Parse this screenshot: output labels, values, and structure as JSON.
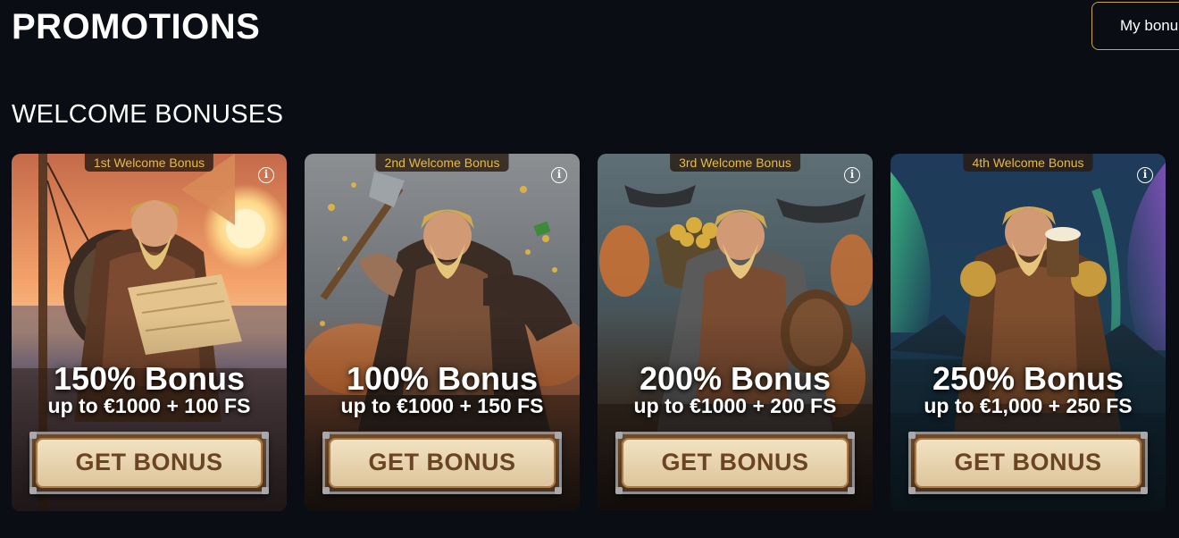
{
  "header": {
    "title": "PROMOTIONS",
    "my_bonus_label": "My bonu"
  },
  "section": {
    "title": "WELCOME BONUSES"
  },
  "cards": [
    {
      "badge": "1st Welcome Bonus",
      "title": "150% Bonus",
      "subtitle": "up to €1000 + 100 FS",
      "cta": "GET BONUS"
    },
    {
      "badge": "2nd Welcome Bonus",
      "title": "100% Bonus",
      "subtitle": "up to €1000 + 150 FS",
      "cta": "GET BONUS"
    },
    {
      "badge": "3rd Welcome Bonus",
      "title": "200% Bonus",
      "subtitle": "up to €1000 + 200 FS",
      "cta": "GET BONUS"
    },
    {
      "badge": "4th Welcome Bonus",
      "title": "250% Bonus",
      "subtitle": "up to €1,000 + 250 FS",
      "cta": "GET BONUS"
    }
  ],
  "icons": {
    "info": "info-icon"
  },
  "colors": {
    "background": "#0a0d13",
    "accent_gold": "#c9a44a",
    "badge_text": "#e6b94a",
    "cta_text": "#6a4423"
  }
}
